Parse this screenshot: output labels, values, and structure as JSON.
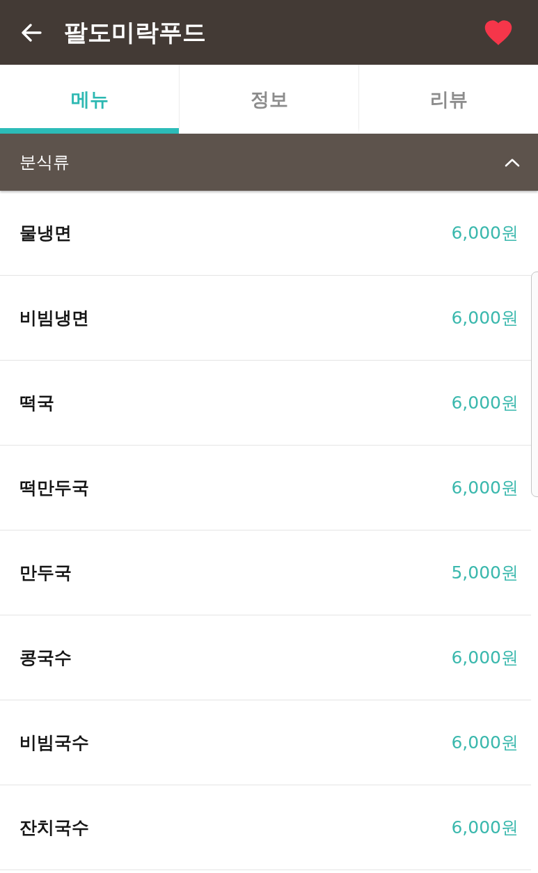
{
  "header": {
    "title": "팔도미락푸드",
    "favorite": true
  },
  "tabs": [
    {
      "label": "메뉴",
      "selected": true
    },
    {
      "label": "정보",
      "selected": false
    },
    {
      "label": "리뷰",
      "selected": false
    }
  ],
  "category": {
    "title": "분식류",
    "expanded": true
  },
  "menu_items": [
    {
      "name": "물냉면",
      "price": "6,000원"
    },
    {
      "name": "비빔냉면",
      "price": "6,000원"
    },
    {
      "name": "떡국",
      "price": "6,000원"
    },
    {
      "name": "떡만두국",
      "price": "6,000원"
    },
    {
      "name": "만두국",
      "price": "5,000원"
    },
    {
      "name": "콩국수",
      "price": "6,000원"
    },
    {
      "name": "비빔국수",
      "price": "6,000원"
    },
    {
      "name": "잔치국수",
      "price": "6,000원"
    }
  ]
}
